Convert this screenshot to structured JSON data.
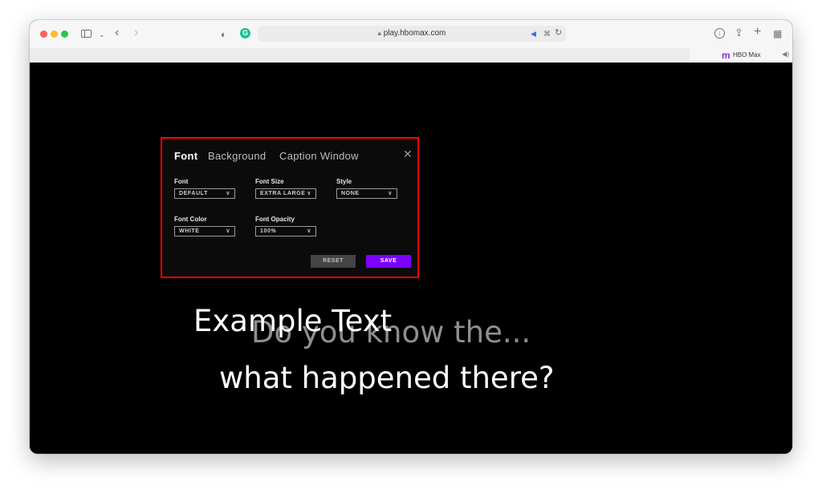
{
  "browser": {
    "url": "play.hbomax.com",
    "tab": {
      "title": "HBO Max"
    },
    "icons": [
      "sidebar-icon",
      "chevron-down-icon",
      "back-icon",
      "forward-icon",
      "shield-icon",
      "grammarly-icon",
      "lock-icon",
      "speaker-icon",
      "translate-icon",
      "reload-icon",
      "download-icon",
      "share-icon",
      "new-tab-icon",
      "tab-overview-icon"
    ]
  },
  "captions_panel": {
    "tabs": [
      "Font",
      "Background",
      "Caption Window"
    ],
    "active_tab": "Font",
    "fields": {
      "font": {
        "label": "Font",
        "value": "DEFAULT"
      },
      "font_size": {
        "label": "Font Size",
        "value": "EXTRA LARGE"
      },
      "style": {
        "label": "Style",
        "value": "NONE"
      },
      "font_color": {
        "label": "Font Color",
        "value": "WHITE"
      },
      "font_opacity": {
        "label": "Font Opacity",
        "value": "100%"
      }
    },
    "buttons": {
      "reset": "RESET",
      "save": "SAVE"
    },
    "accent_color": "#7b00ff",
    "highlight_border_color": "#ff0000"
  },
  "subtitles": {
    "example": "Example Text",
    "line1": "Do you know the...",
    "line2": "what happened there?"
  }
}
